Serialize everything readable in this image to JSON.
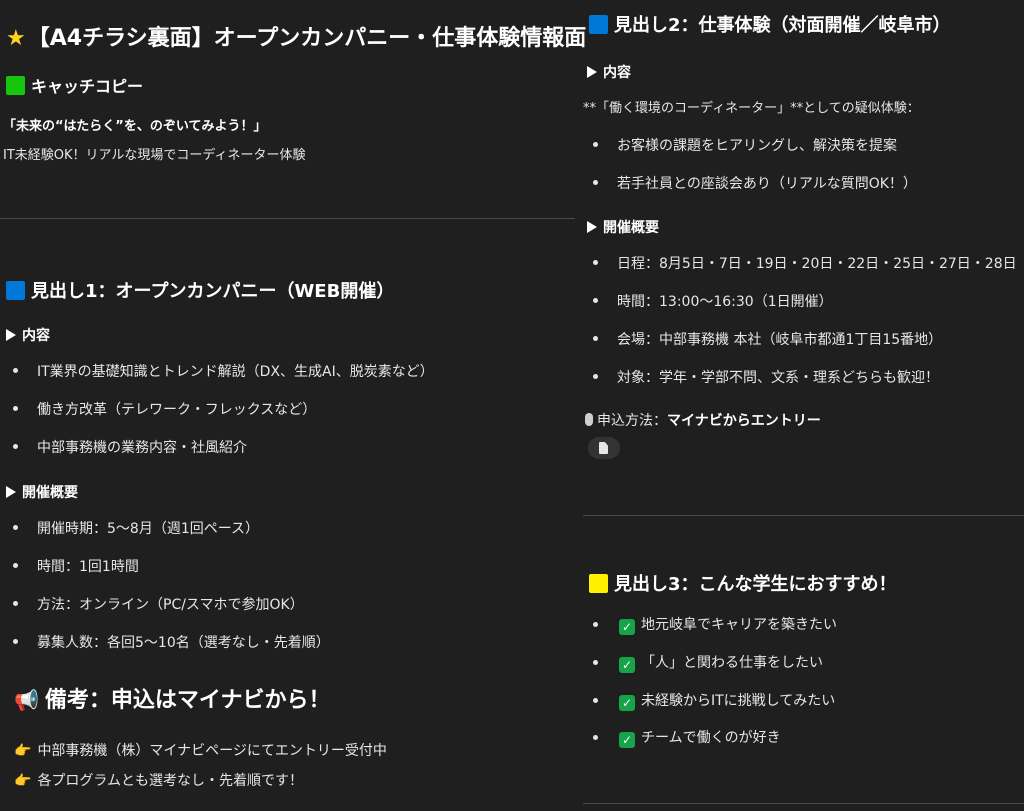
{
  "left": {
    "title": "【A4チラシ裏面】オープンカンパニー・仕事体験情報面",
    "catch": {
      "heading": "キャッチコピー",
      "line1": "「未来の“はたらく”を、のぞいてみよう！」",
      "line2": "IT未経験OK！リアルな現場でコーディネーター体験"
    },
    "section1": {
      "heading": "見出し1：オープンカンパニー（WEB開催）",
      "content_label": "内容",
      "content_items": [
        "IT業界の基礎知識とトレンド解説（DX、生成AI、脱炭素など）",
        "働き方改革（テレワーク・フレックスなど）",
        "中部事務機の業務内容・社風紹介"
      ],
      "overview_label": "開催概要",
      "overview_items": [
        "開催時期：5〜8月（週1回ペース）",
        "時間：1回1時間",
        "方法：オンライン（PC/スマホで参加OK）",
        "募集人数：各回5〜10名（選考なし・先着順）"
      ]
    },
    "notes": {
      "heading": "備考：申込はマイナビから！",
      "items": [
        "中部事務機（株）マイナビページにてエントリー受付中",
        "各プログラムとも選考なし・先着順です！"
      ]
    }
  },
  "right": {
    "section2": {
      "heading": "見出し2：仕事体験（対面開催／岐阜市）",
      "content_label": "内容",
      "intro": "**「働く環境のコーディネーター」**としての疑似体験：",
      "content_items": [
        "お客様の課題をヒアリングし、解決策を提案",
        "若手社員との座談会あり（リアルな質問OK！）"
      ],
      "overview_label": "開催概要",
      "overview_items": [
        "日程：8月5日・7日・19日・20日・22日・25日・27日・28日",
        "時間：13:00〜16:30（1日開催）",
        "会場：中部事務機 本社（岐阜市都通1丁目15番地）",
        "対象：学年・学部不問、文系・理系どちらも歓迎！"
      ],
      "apply_label": "申込方法：",
      "apply_value": "マイナビからエントリー"
    },
    "section3": {
      "heading": "見出し3：こんな学生におすすめ！",
      "items": [
        "地元岐阜でキャリアを築きたい",
        "「人」と関わる仕事をしたい",
        "未経験からITに挑戦してみたい",
        "チームで働くのが好き"
      ]
    }
  },
  "icons": {
    "star": "star-icon",
    "green_square": "green-square-icon",
    "blue_square": "blue-square-icon",
    "yellow_square": "yellow-square-icon",
    "triangle": "triangle-right-icon",
    "megaphone": "megaphone-icon",
    "pointer": "pointing-hand-icon",
    "check": "check-mark-icon",
    "mouse": "mouse-icon",
    "file": "file-icon"
  },
  "colors": {
    "background": "#1f1f1f",
    "green": "#16c60c",
    "blue": "#0078d7",
    "yellow": "#fff100",
    "check": "#16a34a"
  }
}
